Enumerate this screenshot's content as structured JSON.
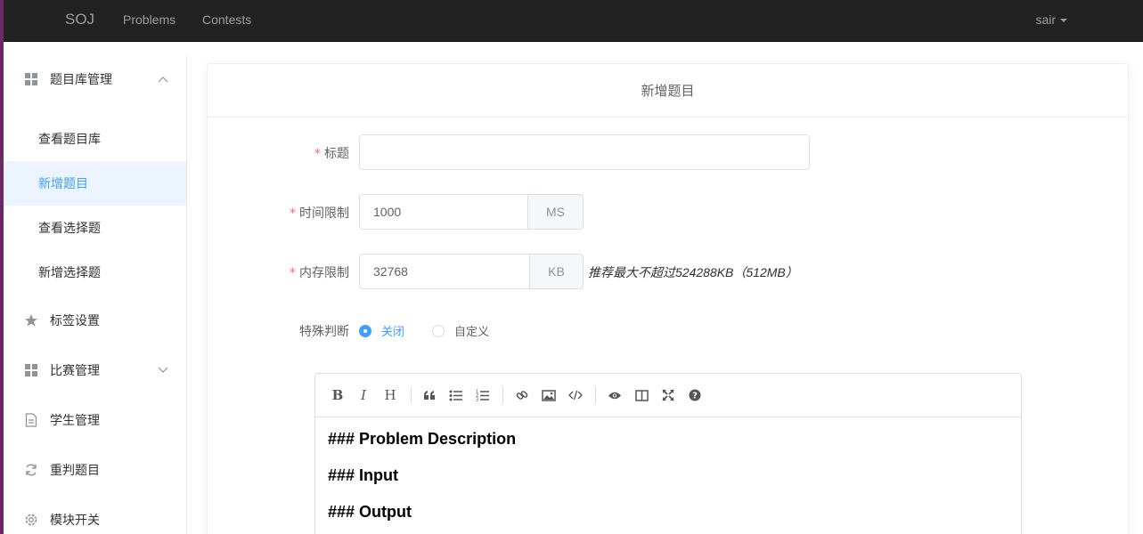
{
  "navbar": {
    "brand": "SOJ",
    "links": [
      "Problems",
      "Contests"
    ],
    "user": "sair"
  },
  "sidebar": {
    "groups": [
      {
        "label": "题目库管理",
        "icon": "grid-icon",
        "expanded": true
      },
      {
        "label": "标签设置",
        "icon": "star-icon"
      },
      {
        "label": "比赛管理",
        "icon": "grid-icon",
        "expanded": false
      },
      {
        "label": "学生管理",
        "icon": "document-icon"
      },
      {
        "label": "重判题目",
        "icon": "refresh-icon"
      },
      {
        "label": "模块开关",
        "icon": "gear-icon"
      }
    ],
    "sub_items": [
      {
        "label": "查看题目库"
      },
      {
        "label": "新增题目",
        "active": true
      },
      {
        "label": "查看选择题"
      },
      {
        "label": "新增选择题"
      }
    ]
  },
  "card": {
    "title": "新增题目"
  },
  "form": {
    "title_label": "标题",
    "title_value": "",
    "time_label": "时间限制",
    "time_value": "1000",
    "time_unit": "MS",
    "memory_label": "内存限制",
    "memory_value": "32768",
    "memory_unit": "KB",
    "memory_hint": "推荐最大不超过524288KB（512MB）",
    "special_label": "特殊判断",
    "special_options": [
      {
        "label": "关闭",
        "checked": true
      },
      {
        "label": "自定义",
        "checked": false
      }
    ]
  },
  "editor": {
    "toolbar_icons": [
      "bold-icon",
      "italic-icon",
      "heading-icon",
      "quote-icon",
      "unordered-list-icon",
      "ordered-list-icon",
      "link-icon",
      "image-icon",
      "code-icon",
      "preview-icon",
      "side-by-side-icon",
      "fullscreen-icon",
      "help-icon"
    ],
    "lines": [
      "### Problem Description",
      "### Input",
      "### Output"
    ]
  },
  "colors": {
    "accent": "#409eff",
    "navbar_bg": "#222222",
    "required": "#f56c6c"
  }
}
